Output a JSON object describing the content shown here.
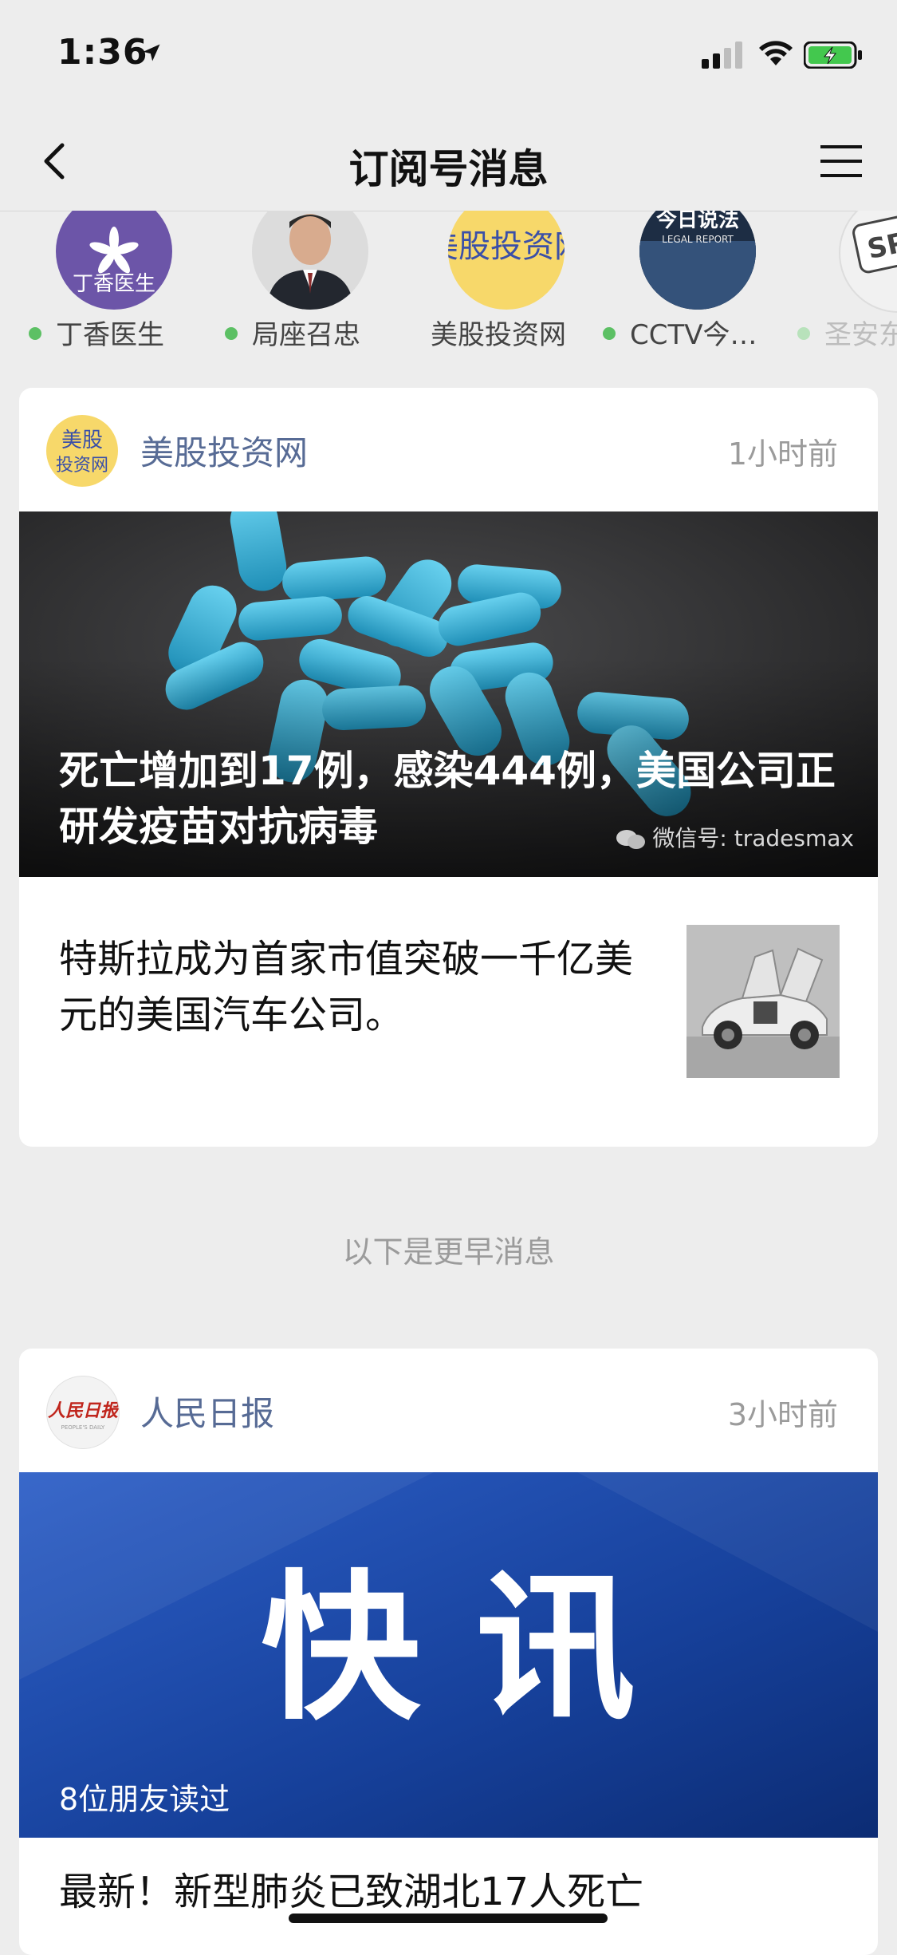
{
  "status_bar": {
    "time": "1:36"
  },
  "nav": {
    "title": "订阅号消息"
  },
  "accounts": [
    {
      "label": "丁香医生",
      "unread": true
    },
    {
      "label": "局座召忠",
      "unread": true
    },
    {
      "label": "美股投资网",
      "unread": false
    },
    {
      "label": "CCTV今…",
      "unread": true
    },
    {
      "label": "圣安东",
      "unread": true
    }
  ],
  "avatar_text": {
    "dingxiang": "丁香医生",
    "meigu": "美股投资网",
    "cctv_top": "今日说法",
    "cctv_sub": "LEGAL REPORT"
  },
  "card1": {
    "account": "美股投资网",
    "time": "1小时前",
    "headline": "死亡增加到17例，感染444例，美国公司正研发疫苗对抗病毒",
    "watermark": "微信号: tradesmax",
    "item_text": "特斯拉成为首家市值突破一千亿美元的美国汽车公司。"
  },
  "divider": "以下是更早消息",
  "card2": {
    "account": "人民日报",
    "time": "3小时前",
    "hero_text": "快 讯",
    "read_by": "8位朋友读过",
    "item_text": "最新！新型肺炎已致湖北17人死亡"
  },
  "colors": {
    "account_name": "#576b95",
    "unread_dot": "#5cc064",
    "background": "#ededed"
  }
}
